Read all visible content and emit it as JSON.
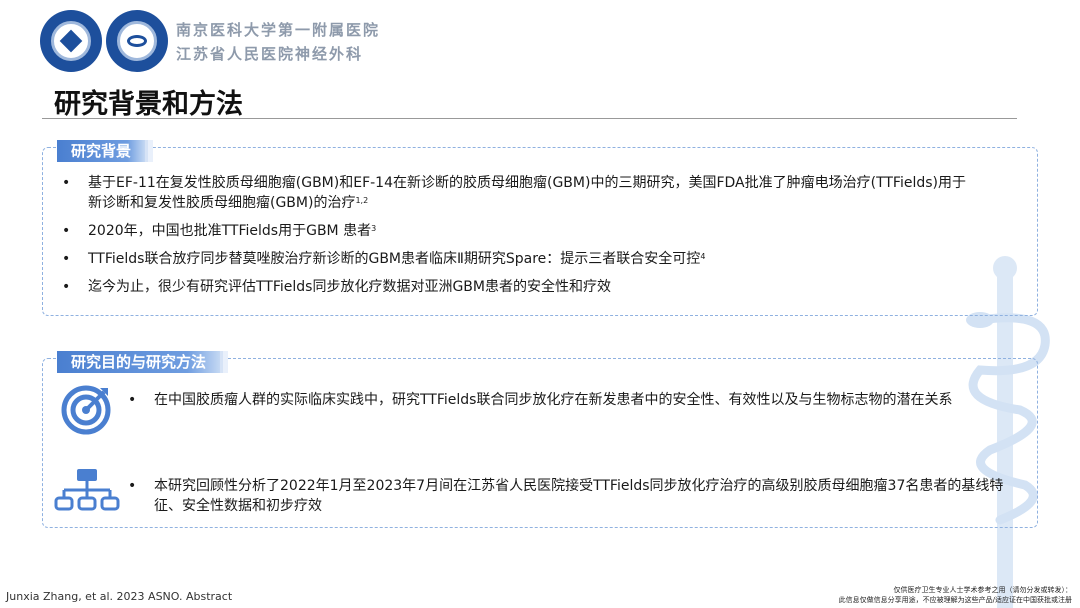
{
  "header": {
    "hospital_line1": "南京医科大学第一附属医院",
    "hospital_line2": "江苏省人民医院神经外科"
  },
  "title": "研究背景和方法",
  "background": {
    "tag": "研究背景",
    "items": [
      {
        "text": "基于EF-11在复发性胶质母细胞瘤(GBM)和EF-14在新诊断的胶质母细胞瘤(GBM)中的三期研究，美国FDA批准了肿瘤电场治疗(TTFields)用于新诊断和复发性胶质母细胞瘤(GBM)的治疗",
        "sup": "1,2"
      },
      {
        "text": "2020年，中国也批准TTFields用于GBM 患者",
        "sup": "3"
      },
      {
        "text": "TTFields联合放疗同步替莫唑胺治疗新诊断的GBM患者临床Ⅱ期研究Spare：提示三者联合安全可控",
        "sup": "4"
      },
      {
        "text": "迄今为止，很少有研究评估TTFields同步放化疗数据对亚洲GBM患者的安全性和疗效",
        "sup": ""
      }
    ]
  },
  "methods": {
    "tag": "研究目的与研究方法",
    "items": [
      {
        "text": "在中国胶质瘤人群的实际临床实践中，研究TTFields联合同步放化疗在新发患者中的安全性、有效性以及与生物标志物的潜在关系",
        "icon": "target-icon"
      },
      {
        "text": "本研究回顾性分析了2022年1月至2023年7月间在江苏省人民医院接受TTFields同步放化疗治疗的高级别胶质母细胞瘤37名患者的基线特征、安全性数据和初步疗效",
        "icon": "hierarchy-icon"
      }
    ]
  },
  "footer": {
    "citation": "Junxia Zhang, et al. 2023 ASNO. Abstract",
    "disclaimer_line1": "仅供医疗卫生专业人士学术参考之用（请勿分发或转发）：",
    "disclaimer_line2": "此信息仅做信息分享用途，不应被理解为这些产品/适应证在中国获批或注册"
  },
  "colors": {
    "accent": "#4a7fd0",
    "title": "#111111",
    "hospital_text": "#8e9aab"
  }
}
